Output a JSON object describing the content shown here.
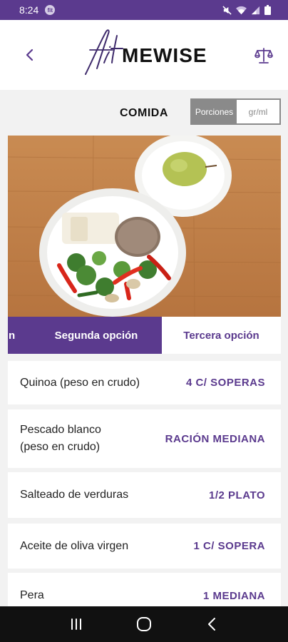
{
  "status_bar": {
    "time": "8:24",
    "notif_badge": "fit"
  },
  "header": {
    "logo_script": "fit",
    "logo_text": "MEWISE"
  },
  "section": {
    "title": "COMIDA"
  },
  "unit_toggle": {
    "active": "Porciones",
    "inactive": "gr/ml"
  },
  "tabs": [
    {
      "label": "n",
      "state": "partial"
    },
    {
      "label": "Segunda opción",
      "state": "active"
    },
    {
      "label": "Tercera opción",
      "state": "inactive"
    }
  ],
  "foods": [
    {
      "name": "Quinoa (peso en crudo)",
      "qty": "4 C/ SOPERAS"
    },
    {
      "name": "Pescado blanco (peso en crudo)",
      "qty": "RACIÓN MEDIANA"
    },
    {
      "name": "Salteado de verduras",
      "qty": "1/2 PLATO"
    },
    {
      "name": "Aceite de oliva virgen",
      "qty": "1 C/ SOPERA"
    },
    {
      "name": "Pera",
      "qty": "1 MEDIANA"
    }
  ],
  "colors": {
    "brand": "#5b3a8e",
    "toggle_gray": "#8a8a8a",
    "background": "#f2f2f2"
  },
  "icons": [
    "back-chevron-icon",
    "scale-icon",
    "mute-icon",
    "wifi-icon",
    "signal-icon",
    "battery-icon",
    "recents-icon",
    "home-icon",
    "back-icon"
  ]
}
